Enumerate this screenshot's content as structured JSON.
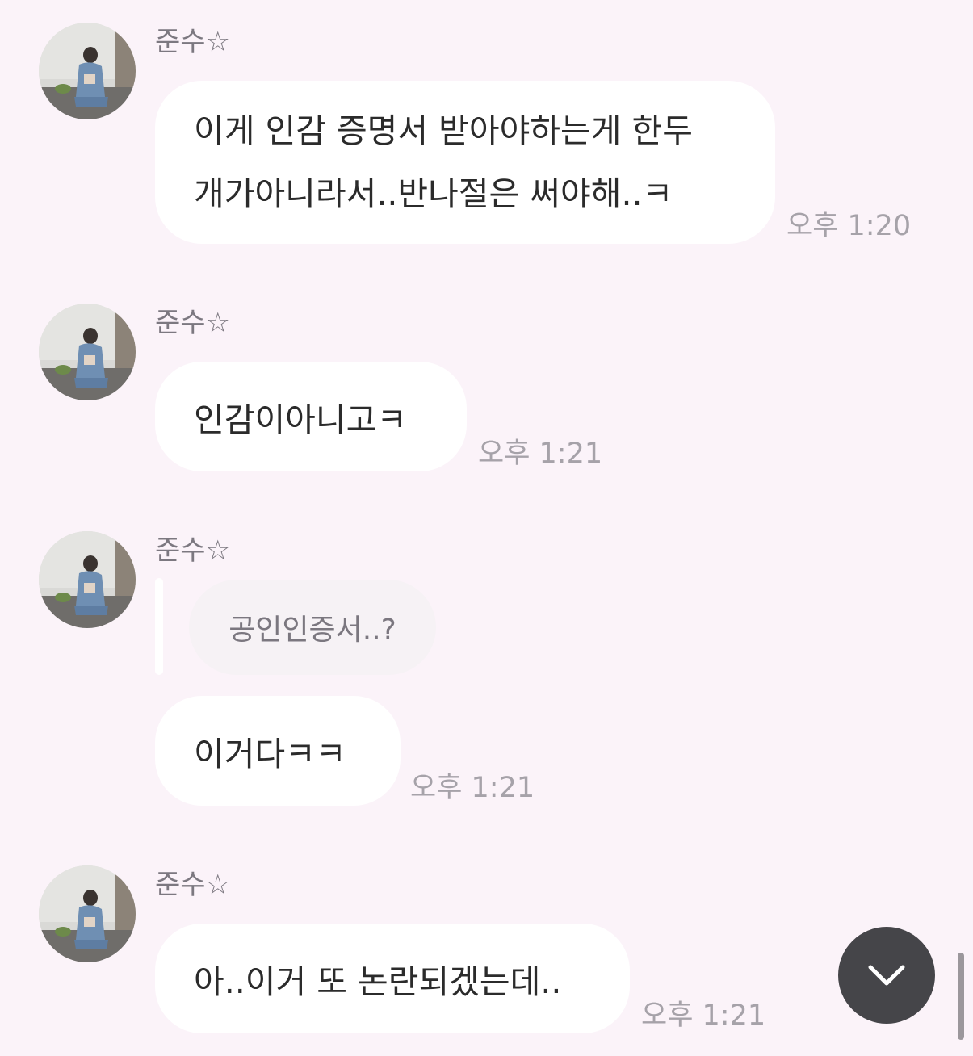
{
  "chat": {
    "messages": [
      {
        "sender": "준수☆",
        "lines": [
          "이게 인감 증명서 받아야하는게 한두",
          "개가아니라서..반나절은 써야해..ㅋ"
        ],
        "time": "오후 1:20"
      },
      {
        "sender": "준수☆",
        "text": "인감이아니고ㅋ",
        "time": "오후 1:21"
      },
      {
        "sender": "준수☆",
        "reply_quote": "공인인증서..?",
        "text": "이거다ㅋㅋ",
        "time": "오후 1:21"
      },
      {
        "sender": "준수☆",
        "text": "아..이거 또 논란되겠는데..",
        "time": "오후 1:21"
      }
    ]
  },
  "icons": {
    "scroll_down": "chevron-down-icon",
    "avatar": "profile-photo"
  },
  "colors": {
    "background": "#fbf3f9",
    "bubble": "#ffffff",
    "timestamp": "#a6a2a9",
    "sender": "#7c7880",
    "scroll_button": "#454549"
  }
}
